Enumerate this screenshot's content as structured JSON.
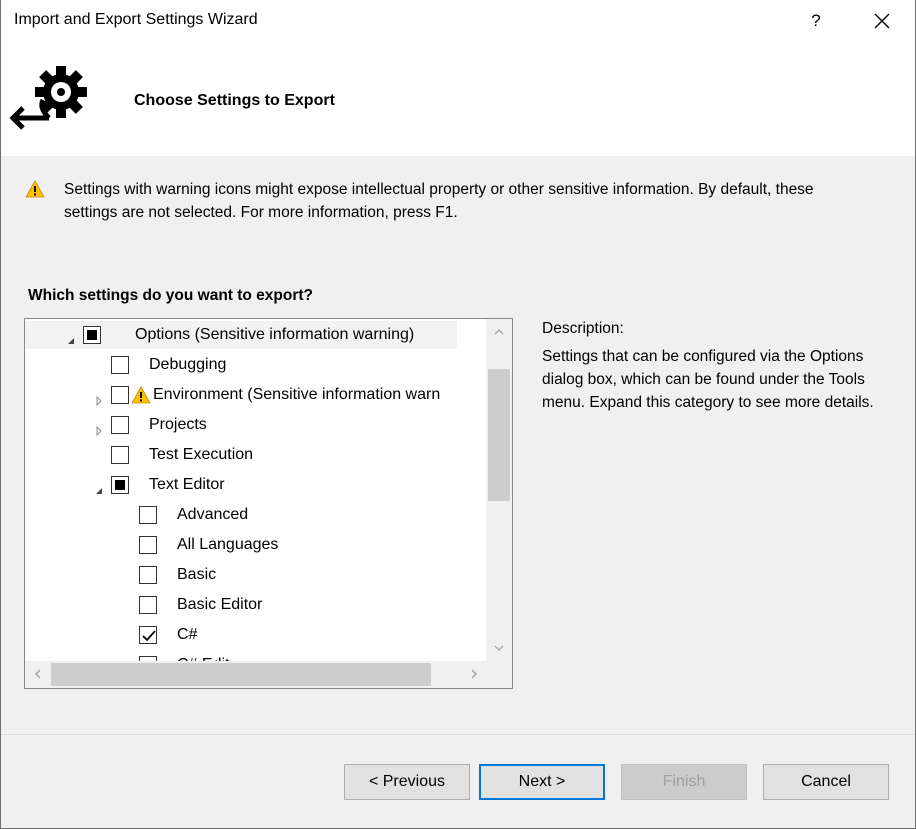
{
  "window": {
    "title": "Import and Export Settings Wizard",
    "help_label": "?"
  },
  "header": {
    "page_title": "Choose Settings to Export"
  },
  "warning": {
    "text": "Settings with warning icons might expose intellectual property or other sensitive information. By default, these settings are not selected. For more information, press F1."
  },
  "tree": {
    "question": "Which settings do you want to export?",
    "rows": [
      {
        "label": "Options (Sensitive information warning)",
        "state": "partial",
        "expander": "expanded",
        "level": 0,
        "warning": false,
        "highlighted": true
      },
      {
        "label": "Debugging",
        "state": "unchecked",
        "expander": "none",
        "level": 1,
        "warning": false
      },
      {
        "label": "Environment (Sensitive information warn",
        "state": "unchecked",
        "expander": "collapsed",
        "level": 1,
        "warning": true
      },
      {
        "label": "Projects",
        "state": "unchecked",
        "expander": "collapsed",
        "level": 1,
        "warning": false
      },
      {
        "label": "Test Execution",
        "state": "unchecked",
        "expander": "none",
        "level": 1,
        "warning": false
      },
      {
        "label": "Text Editor",
        "state": "partial",
        "expander": "expanded",
        "level": 1,
        "warning": false
      },
      {
        "label": "Advanced",
        "state": "unchecked",
        "expander": "none",
        "level": 2,
        "warning": false
      },
      {
        "label": "All Languages",
        "state": "unchecked",
        "expander": "none",
        "level": 2,
        "warning": false
      },
      {
        "label": "Basic",
        "state": "unchecked",
        "expander": "none",
        "level": 2,
        "warning": false
      },
      {
        "label": "Basic Editor",
        "state": "unchecked",
        "expander": "none",
        "level": 2,
        "warning": false
      },
      {
        "label": "C#",
        "state": "checked",
        "expander": "none",
        "level": 2,
        "warning": false
      },
      {
        "label": "C# Edit",
        "state": "unchecked",
        "expander": "none",
        "level": 2,
        "warning": false
      }
    ]
  },
  "description": {
    "label": "Description:",
    "text": "Settings that can be configured via the Options dialog box, which can be found under the Tools menu. Expand this category to see more details."
  },
  "buttons": {
    "previous": "< Previous",
    "next": "Next >",
    "finish": "Finish",
    "cancel": "Cancel"
  },
  "colors": {
    "accent": "#0078d7",
    "warning_yellow": "#ffc000",
    "header_bg": "#ffffff",
    "dialog_bg": "#f0f0f0"
  },
  "icons": {
    "wizard": "gear-export-icon",
    "warning": "warning-icon",
    "close": "close-icon"
  }
}
